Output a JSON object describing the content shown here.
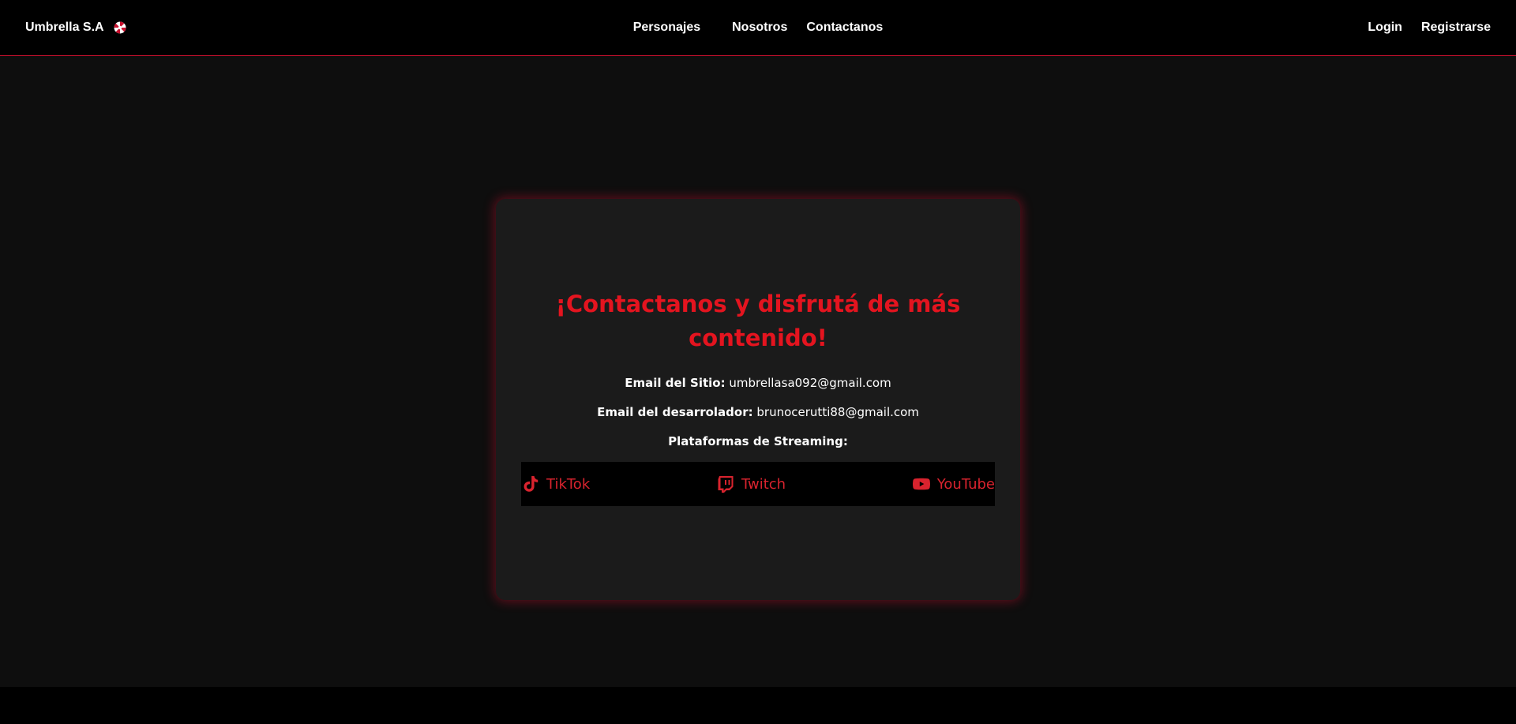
{
  "navbar": {
    "brand": "Umbrella S.A",
    "brand_icon": "umbrella-corp-logo-icon",
    "center_links": [
      "Personajes",
      "Nosotros",
      "Contactanos"
    ],
    "right_links": [
      "Login",
      "Registrarse"
    ],
    "border_color": "#c8102e"
  },
  "contact": {
    "title": "¡Contactanos y disfrutá de más contenido!",
    "site_email_label": "Email del Sitio:",
    "site_email_value": "umbrellasa092@gmail.com",
    "dev_email_label": "Email del desarrolador:",
    "dev_email_value": "brunocerutti88@gmail.com",
    "streaming_label": "Plataformas de Streaming:",
    "platforms": [
      {
        "name": "TikTok",
        "icon": "tiktok-icon"
      },
      {
        "name": "Twitch",
        "icon": "twitch-icon"
      },
      {
        "name": "YouTube",
        "icon": "youtube-icon"
      }
    ]
  },
  "colors": {
    "accent_red": "#e4141f",
    "link_red": "#d9232e",
    "background": "#0e0e0e",
    "card": "#1b1b1b"
  }
}
